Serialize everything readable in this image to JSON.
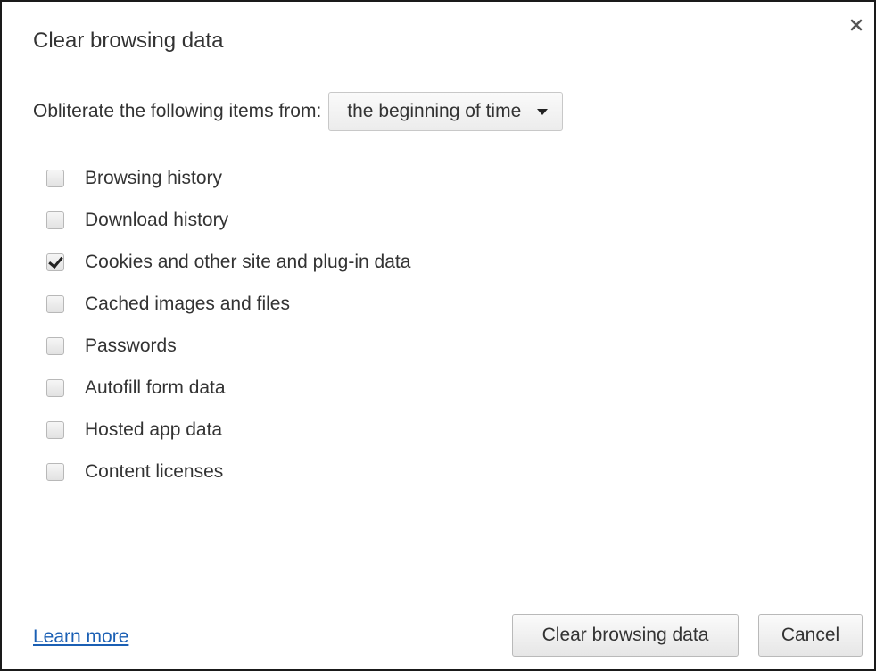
{
  "dialog": {
    "title": "Clear browsing data",
    "close_glyph": "×"
  },
  "range": {
    "label": "Obliterate the following items from:",
    "selected": "the beginning of time"
  },
  "options": [
    {
      "label": "Browsing history",
      "checked": false
    },
    {
      "label": "Download history",
      "checked": false
    },
    {
      "label": "Cookies and other site and plug-in data",
      "checked": true
    },
    {
      "label": "Cached images and files",
      "checked": false
    },
    {
      "label": "Passwords",
      "checked": false
    },
    {
      "label": "Autofill form data",
      "checked": false
    },
    {
      "label": "Hosted app data",
      "checked": false
    },
    {
      "label": "Content licenses",
      "checked": false
    }
  ],
  "footer": {
    "learn_more": "Learn more",
    "clear_button": "Clear browsing data",
    "cancel_button": "Cancel"
  },
  "colors": {
    "link": "#1a5fb4",
    "text": "#333333"
  },
  "icons": {
    "close": "close-icon",
    "dropdown": "chevron-down-icon",
    "check": "checkmark-icon"
  }
}
